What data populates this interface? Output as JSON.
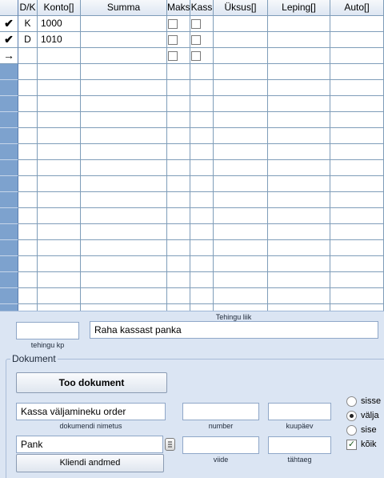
{
  "grid": {
    "columns": [
      "D/K",
      "Konto[]",
      "Summa",
      "Maks",
      "Kass",
      "Üksus[]",
      "Leping[]",
      "Auto[]"
    ],
    "rows": [
      {
        "marker": "✔",
        "dk": "K",
        "konto": "1000",
        "summa": "",
        "maks": false,
        "kass": false,
        "yksus": "",
        "leping": "",
        "auto": ""
      },
      {
        "marker": "✔",
        "dk": "D",
        "konto": "1010",
        "summa": "",
        "maks": false,
        "kass": false,
        "yksus": "",
        "leping": "",
        "auto": ""
      },
      {
        "marker": "→",
        "dk": "",
        "konto": "",
        "summa": "",
        "maks": false,
        "kass": false,
        "yksus": "",
        "leping": "",
        "auto": ""
      }
    ]
  },
  "panel": {
    "tehingu_liik_label": "Tehingu liik",
    "tehingu_kp_label": "tehingu kp",
    "tehingu_kp_value": "",
    "tehingu_liik_value": "Raha kassast panka",
    "dokument_legend": "Dokument",
    "too_dokument_button": "Too dokument",
    "dokumendi_nimetus_value": "Kassa väljamineku order",
    "dokumendi_nimetus_label": "dokumendi nimetus",
    "number_label": "number",
    "number_value": "",
    "kuupaev_label": "kuupäev",
    "kuupaev_value": "",
    "pank_value": "Pank",
    "kliendi_andmed_button": "Kliendi andmed",
    "viide_label": "viide",
    "viide_value": "",
    "tahtaeg_label": "tähtaeg",
    "tahtaeg_value": "",
    "direction_options": [
      {
        "label": "sisse",
        "selected": false
      },
      {
        "label": "välja",
        "selected": true
      },
      {
        "label": "sise",
        "selected": false
      }
    ],
    "koik_label": "kõik",
    "koik_checked": true
  }
}
